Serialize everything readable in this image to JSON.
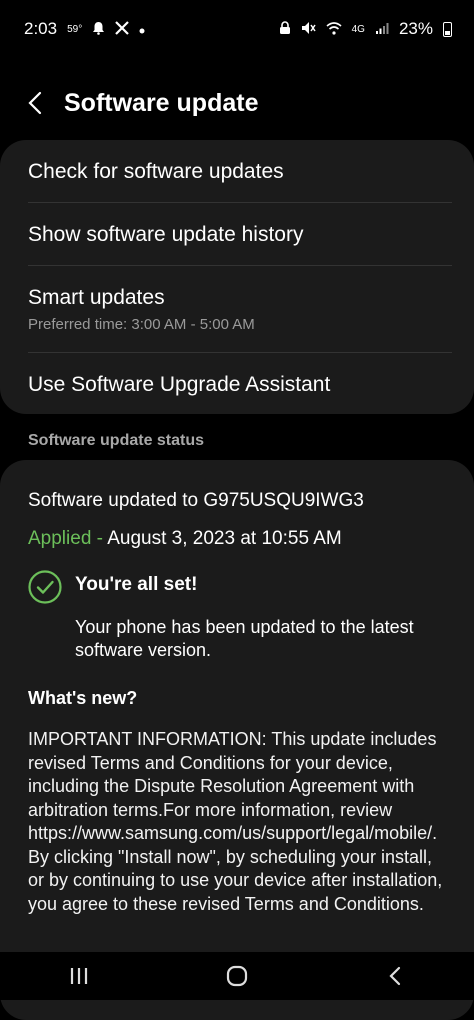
{
  "status_bar": {
    "time": "2:03",
    "temp": "59°",
    "network": "4G",
    "battery": "23%"
  },
  "header": {
    "title": "Software update"
  },
  "menu": {
    "items": [
      {
        "label": "Check for software updates"
      },
      {
        "label": "Show software update history"
      },
      {
        "label": "Smart updates",
        "sub": "Preferred time: 3:00 AM - 5:00 AM"
      },
      {
        "label": "Use Software Upgrade Assistant"
      }
    ]
  },
  "status": {
    "section_label": "Software update status",
    "updated_to": "Software updated to G975USQU9IWG3",
    "applied_label": "Applied - ",
    "applied_date": "August 3, 2023 at 10:55 AM",
    "allset_title": "You're all set!",
    "allset_desc": "Your phone has been updated to the latest software version.",
    "whats_new_title": "What's new?",
    "notes": "IMPORTANT INFORMATION: This update includes revised Terms and Conditions for your device, including the Dispute Resolution Agreement with arbitration terms.For more information, review https://www.samsung.com/us/support/legal/mobile/. By clicking \"Install now\", by scheduling your install, or by continuing to use your device after installation, you agree to these revised Terms and Conditions."
  },
  "colors": {
    "accent_green": "#6cbf5a",
    "card_bg": "#1b1b1b"
  },
  "icons": {
    "back": "chevron-left-icon",
    "check": "check-circle-icon",
    "nav_recents": "recents-icon",
    "nav_home": "home-icon",
    "nav_back": "back-icon"
  }
}
